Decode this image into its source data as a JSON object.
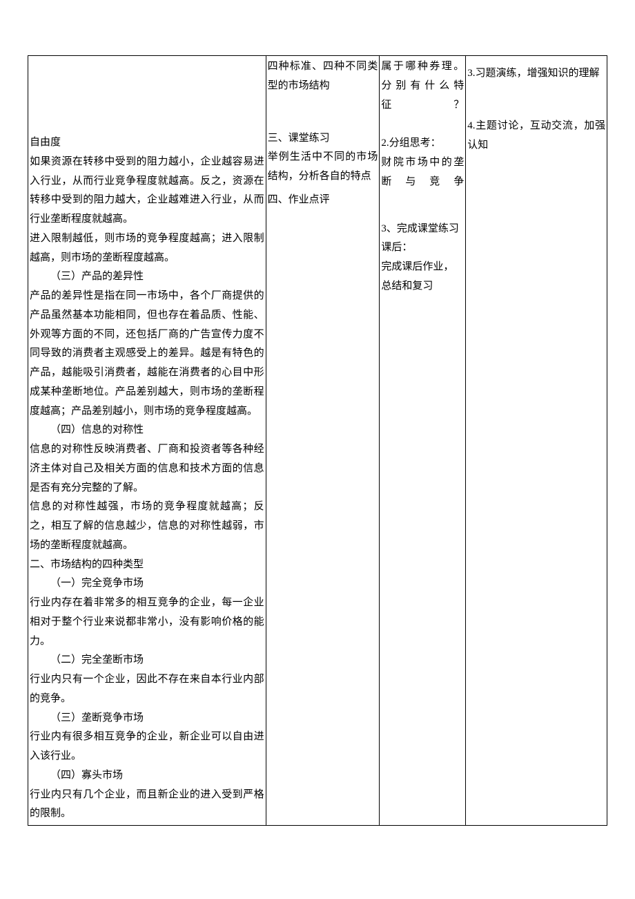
{
  "col1": {
    "p_freedom_title": "自由度",
    "p_freedom_1": "如果资源在转移中受到的阻力越小，企业越容易进入行业，从而行业竞争程度就越高。反之，资源在转移中受到的阻力越大，企业越难进入行业，从而行业垄断程度就越高。",
    "p_freedom_2": "进入限制越低，则市场的竞争程度越高；进入限制越高，则市场的垄断程度越高。",
    "p_diff_title": "（三）产品的差异性",
    "p_diff_1": "产品的差异性是指在同一市场中，各个厂商提供的产品虽然基本功能相同，但也存在着品质、性能、外观等方面的不同，还包括厂商的广告宣传力度不同导致的消费者主观感受上的差异。越是有特色的产品，越能吸引消费者，越能在消费者的心目中形成某种垄断地位。产品差别越大，则市场的垄断程度越高；产品差别越小，则市场的竞争程度越高。",
    "p_info_title": "（四）信息的对称性",
    "p_info_1": "信息的对称性反映消费者、厂商和投资者等各种经济主体对自己及相关方面的信息和技术方面的信息是否有充分完整的了解。",
    "p_info_2": "信息的对称性越强，市场的竞争程度就越高；反之，相互了解的信息越少，信息的对称性越弱，市场的垄断程度就越高。",
    "p_types_title": "二、市场结构的四种类型",
    "p_t1_title": "（一）完全竞争市场",
    "p_t1_body": "行业内存在着非常多的相互竞争的企业，每一企业相对于整个行业来说都非常小，没有影响价格的能力。",
    "p_t2_title": "（二）完全垄断市场",
    "p_t2_body": "行业内只有一个企业，因此不存在来自本行业内部的竞争。",
    "p_t3_title": "（三）垄断竞争市场",
    "p_t3_body": "行业内有很多相互竞争的企业，新企业可以自由进入该行业。",
    "p_t4_title": "（四）寡头市场",
    "p_t4_body": "行业内只有几个企业，而且新企业的进入受到严格的限制。"
  },
  "col2": {
    "a1": "四种标准、四种不同类型的市场结构",
    "a2_title": "三、课堂练习",
    "a2_body": "举例生活中不同的市场结构，分析各自的特点",
    "a3": "四、作业点评"
  },
  "col3": {
    "b1": "属于哪种券理。分别有什么特征？",
    "b2_title": "2.分组思考：",
    "b2_body": "财院市场中的垄断与竞争",
    "b3_title": "3、完成课堂练习课后：",
    "b3_body1": "完成课后作业，",
    "b3_body2": " 总结和复习"
  },
  "col4": {
    "c1": "3.习题演练，增强知识的理解",
    "c2": "4.主题讨论，互动交流，加强认知"
  }
}
